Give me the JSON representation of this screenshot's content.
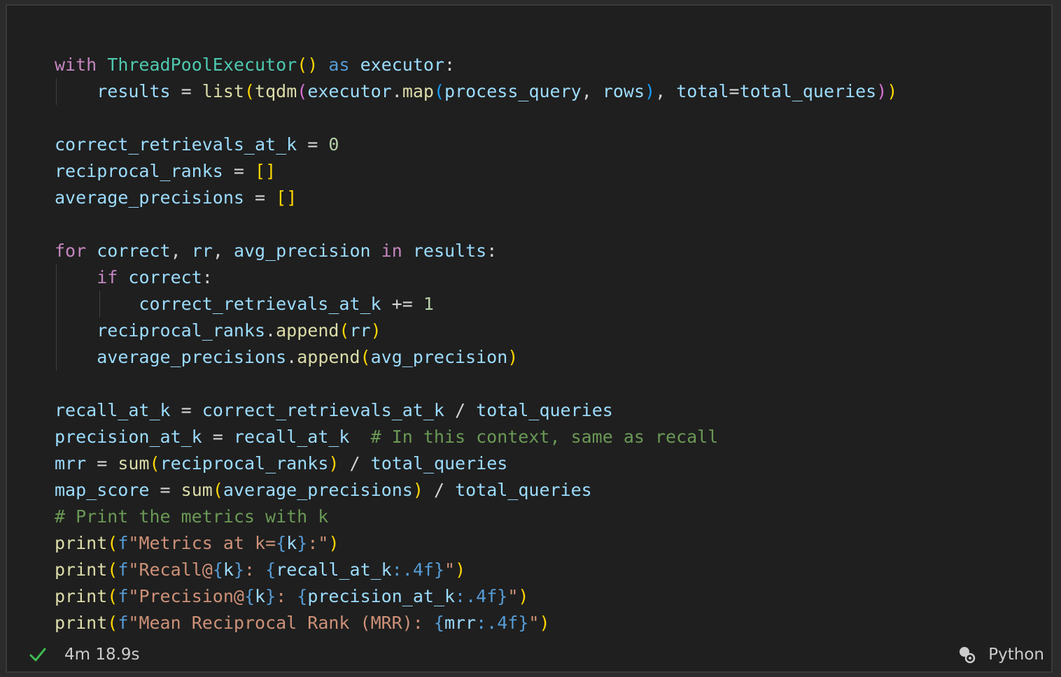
{
  "code": {
    "language": "Python",
    "lines": [
      "with ThreadPoolExecutor() as executor:",
      "    results = list(tqdm(executor.map(process_query, rows), total=total_queries))",
      "",
      "correct_retrievals_at_k = 0",
      "reciprocal_ranks = []",
      "average_precisions = []",
      "",
      "for correct, rr, avg_precision in results:",
      "    if correct:",
      "        correct_retrievals_at_k += 1",
      "    reciprocal_ranks.append(rr)",
      "    average_precisions.append(avg_precision)",
      "",
      "recall_at_k = correct_retrievals_at_k / total_queries",
      "precision_at_k = recall_at_k  # In this context, same as recall",
      "mrr = sum(reciprocal_ranks) / total_queries",
      "map_score = sum(average_precisions) / total_queries",
      "# Print the metrics with k",
      "print(f\"Metrics at k={k}:\")",
      "print(f\"Recall@{k}: {recall_at_k:.4f}\")",
      "print(f\"Precision@{k}: {precision_at_k:.4f}\")",
      "print(f\"Mean Reciprocal Rank (MRR): {mrr:.4f}\")"
    ]
  },
  "status": {
    "execution_time": "4m 18.9s",
    "kernel_language": "Python",
    "success_color": "#3fb950"
  },
  "icons": {
    "success": "checkmark-icon",
    "kernel": "kernel-status-icon"
  }
}
